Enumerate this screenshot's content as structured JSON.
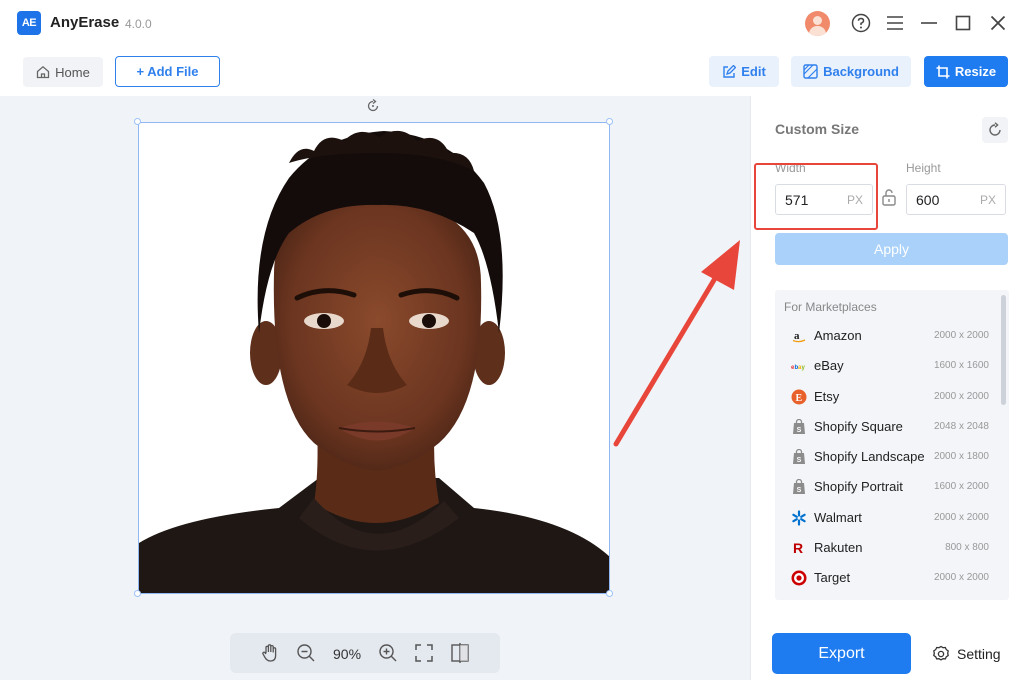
{
  "app": {
    "logo_text": "AE",
    "name": "AnyErase",
    "version": "4.0.0"
  },
  "titlebar": {
    "icons": [
      "avatar-icon",
      "help-icon",
      "menu-icon",
      "minimize-icon",
      "maximize-icon",
      "close-icon"
    ]
  },
  "toolbar": {
    "home_label": "Home",
    "add_file_label": "+ Add File",
    "edit_label": "Edit",
    "background_label": "Background",
    "resize_label": "Resize"
  },
  "canvas": {
    "zoom": "90%"
  },
  "panel": {
    "title": "Custom Size",
    "width_label": "Width",
    "width_value": "571",
    "height_label": "Height",
    "height_value": "600",
    "unit": "PX",
    "apply_label": "Apply",
    "marketplaces_title": "For Marketplaces",
    "marketplaces": [
      {
        "name": "Amazon",
        "size": "2000 x 2000",
        "icon": "amazon-icon"
      },
      {
        "name": "eBay",
        "size": "1600 x 1600",
        "icon": "ebay-icon"
      },
      {
        "name": "Etsy",
        "size": "2000 x 2000",
        "icon": "etsy-icon"
      },
      {
        "name": "Shopify Square",
        "size": "2048 x 2048",
        "icon": "shopify-icon"
      },
      {
        "name": "Shopify Landscape",
        "size": "2000 x 1800",
        "icon": "shopify-icon"
      },
      {
        "name": "Shopify Portrait",
        "size": "1600 x 2000",
        "icon": "shopify-icon"
      },
      {
        "name": "Walmart",
        "size": "2000 x 2000",
        "icon": "walmart-icon"
      },
      {
        "name": "Rakuten",
        "size": "800 x 800",
        "icon": "rakuten-icon"
      },
      {
        "name": "Target",
        "size": "2000 x 2000",
        "icon": "target-icon"
      }
    ]
  },
  "footer": {
    "export_label": "Export",
    "setting_label": "Setting"
  },
  "colors": {
    "accent": "#1e7bf0",
    "highlight": "#e8463a",
    "apply_disabled": "#a9d1f9"
  }
}
